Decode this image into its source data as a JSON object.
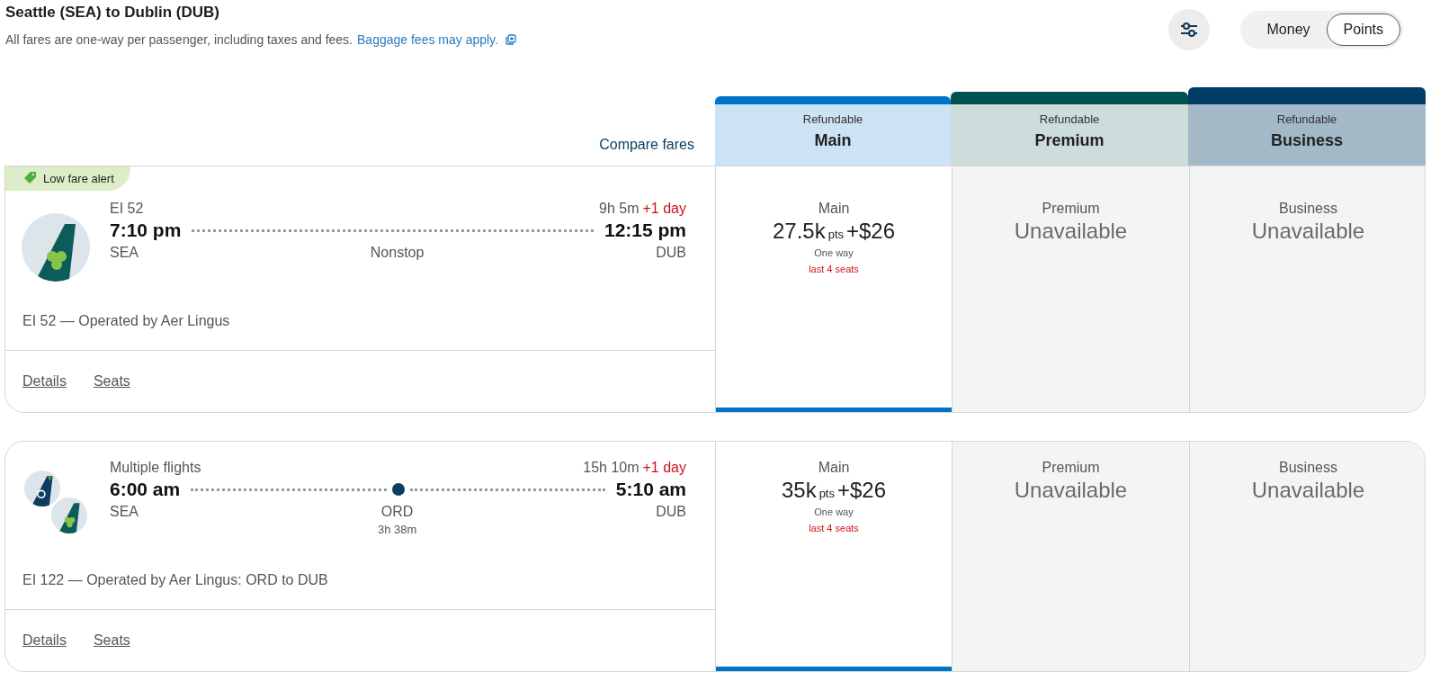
{
  "header": {
    "title": "Seattle (SEA) to Dublin (DUB)",
    "subtitle": "All fares are one-way per passenger, including taxes and fees.",
    "link": "Baggage fees may apply."
  },
  "toggle": [
    {
      "label": "Money",
      "selected": false
    },
    {
      "label": "Points",
      "selected": true
    }
  ],
  "compare_label": "Compare fares",
  "fare_columns": [
    {
      "note": "Refundable",
      "name": "Main",
      "color": "#0074c8"
    },
    {
      "note": "Refundable",
      "name": "Premium",
      "color": "#00534f"
    },
    {
      "note": "Refundable",
      "name": "Business",
      "color": "#003c66"
    }
  ],
  "flights": [
    {
      "badge": "Low fare alert",
      "logos": [
        {
          "kind": "clover",
          "color": "#0b5c5a"
        }
      ],
      "number": "EI 52",
      "duration": "9h 5m",
      "day_change": "+1 day",
      "depart_time": "7:10 pm",
      "arrive_time": "12:15 pm",
      "origin": "SEA",
      "destination": "DUB",
      "stop": {
        "kind": "nonstop",
        "label": "Nonstop"
      },
      "operated": "EI 52 — Operated by Aer Lingus",
      "links": [
        "Details",
        "Seats"
      ],
      "fares": [
        {
          "kind": "price",
          "selected": true,
          "cabin": "Main",
          "points": "27.5k",
          "unit": "pts",
          "plus": "+",
          "cash": "$26",
          "note": "One way",
          "alert": "last 4 seats"
        },
        {
          "kind": "unavailable",
          "selected": false,
          "cabin": "Premium",
          "status": "Unavailable"
        },
        {
          "kind": "unavailable",
          "selected": false,
          "cabin": "Business",
          "status": "Unavailable"
        }
      ]
    },
    {
      "logos": [
        {
          "kind": "portrait",
          "color": "#0d3c5e"
        },
        {
          "kind": "clover",
          "color": "#0b5c5a"
        }
      ],
      "number": "Multiple flights",
      "duration": "15h 10m",
      "day_change": "+1 day",
      "depart_time": "6:00 am",
      "arrive_time": "5:10 am",
      "origin": "SEA",
      "destination": "DUB",
      "stop": {
        "kind": "connection",
        "label": "ORD",
        "layover": "3h 38m"
      },
      "operated": "EI 122 — Operated by Aer Lingus: ORD to DUB",
      "links": [
        "Details",
        "Seats"
      ],
      "fares": [
        {
          "kind": "price",
          "selected": true,
          "cabin": "Main",
          "points": "35k",
          "unit": "pts",
          "plus": "+",
          "cash": "$26",
          "note": "One way",
          "alert": "last 4 seats"
        },
        {
          "kind": "unavailable",
          "selected": false,
          "cabin": "Premium",
          "status": "Unavailable"
        },
        {
          "kind": "unavailable",
          "selected": false,
          "cabin": "Business",
          "status": "Unavailable"
        }
      ]
    }
  ]
}
